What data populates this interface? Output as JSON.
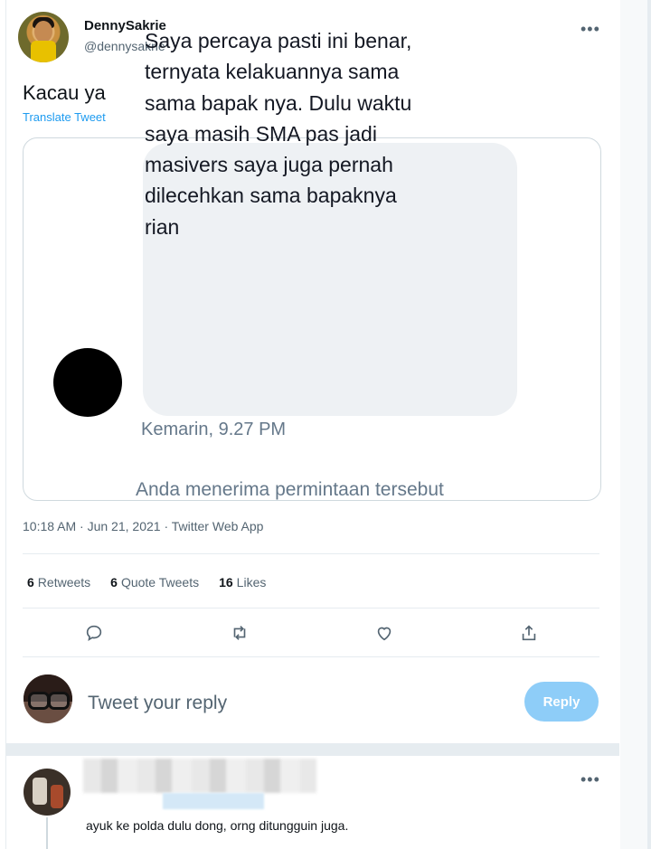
{
  "author": {
    "display_name": "DennySakrie",
    "handle": "@dennysakrie"
  },
  "tweet": {
    "text": "Kacau ya",
    "translate_label": "Translate Tweet",
    "media": {
      "message": "Saya percaya pasti ini benar,\nternyata kelakuannya sama\nsama bapak nya. Dulu waktu\nsaya masih SMA pas jadi\nmasivers saya juga pernah\ndilecehkan sama bapaknya\nrian",
      "time": "Kemarin, 9.27 PM",
      "note": "Anda menerima permintaan tersebut"
    },
    "timestamp": "10:18 AM · Jun 21, 2021 · Twitter Web App"
  },
  "stats": {
    "retweets_count": "6",
    "retweets_label": "Retweets",
    "quotes_count": "6",
    "quotes_label": "Quote Tweets",
    "likes_count": "16",
    "likes_label": "Likes"
  },
  "actions": [
    "reply-icon",
    "retweet-icon",
    "like-icon",
    "share-icon"
  ],
  "reply_box": {
    "placeholder": "Tweet your reply",
    "button_label": "Reply"
  },
  "reply": {
    "text": "ayuk ke polda dulu dong, orng ditungguin juga."
  },
  "colors": {
    "accent": "#1d9bf0",
    "reply_button": "#8ecdf8",
    "secondary_text": "#536471",
    "chat_bubble": "#eef1f4"
  }
}
